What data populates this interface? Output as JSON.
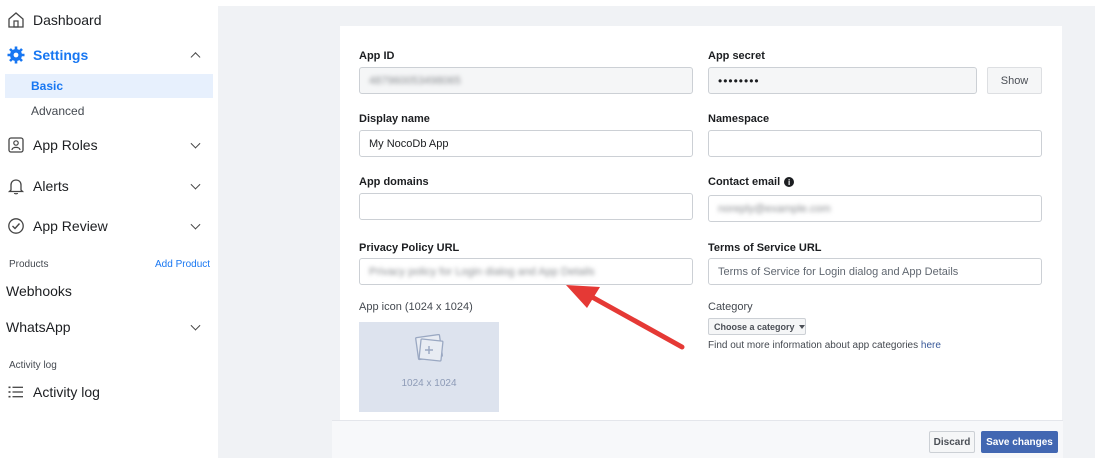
{
  "sidebar": {
    "dashboard": "Dashboard",
    "settings": "Settings",
    "settings_sub": [
      "Basic",
      "Advanced"
    ],
    "app_roles": "App Roles",
    "alerts": "Alerts",
    "app_review": "App Review",
    "products_label": "Products",
    "add_product": "Add Product",
    "webhooks": "Webhooks",
    "whatsapp": "WhatsApp",
    "activity_section": "Activity log",
    "activity_log": "Activity log",
    "accent": "#1877f2"
  },
  "form": {
    "app_id": {
      "label": "App ID",
      "value": "487960053498065"
    },
    "app_secret": {
      "label": "App secret",
      "value": "••••••••",
      "show": "Show"
    },
    "display_name": {
      "label": "Display name",
      "value": "My NocoDb App"
    },
    "namespace": {
      "label": "Namespace",
      "value": ""
    },
    "app_domains": {
      "label": "App domains",
      "value": ""
    },
    "contact_email": {
      "label": "Contact email",
      "value": "noreply@example.com"
    },
    "privacy_url": {
      "label": "Privacy Policy URL",
      "placeholder": "Privacy policy for Login dialog and App Details"
    },
    "tos_url": {
      "label": "Terms of Service URL",
      "placeholder": "Terms of Service for Login dialog and App Details"
    },
    "app_icon": {
      "label": "App icon (1024 x 1024)",
      "size_text": "1024 x 1024"
    },
    "category": {
      "label": "Category",
      "select": "Choose a category",
      "help_text": "Find out more information about app categories",
      "help_link": "here"
    }
  },
  "footer": {
    "discard": "Discard",
    "save": "Save changes"
  },
  "colors": {
    "primary_button": "#4267b2",
    "annotation_arrow": "#e53935",
    "page_bg": "#f0f2f5"
  }
}
